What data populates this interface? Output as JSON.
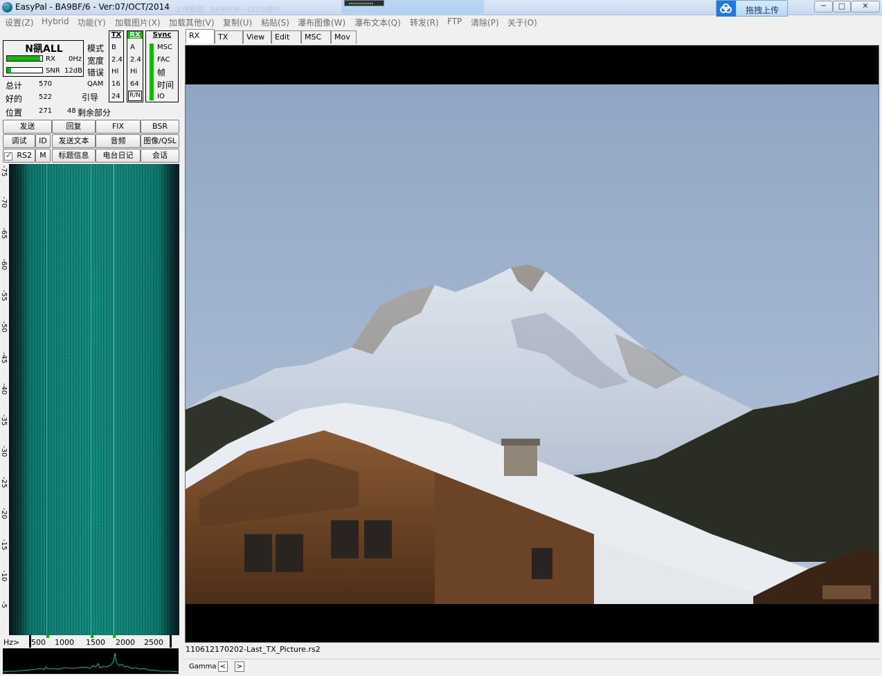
{
  "window": {
    "title": "EasyPal - BA9BF/6 - Ver:07/OCT/2014",
    "taskbar_ghost": "上传截图　BA9BF/6 - 127.0图片",
    "upload_label": "拖拽上传",
    "minimize": "─",
    "maximize": "□",
    "close": "✕"
  },
  "menu": [
    "设置(Z)",
    "Hybrid",
    "功能(Y)",
    "加载图片(X)",
    "加载其他(V)",
    "复制(U)",
    "粘贴(S)",
    "瀑布图像(W)",
    "瀑布文本(Q)",
    "转发(R)",
    "FTP",
    "清除(P)",
    "关于(O)"
  ],
  "status": {
    "mode_title": "N谻ALL",
    "rx_label": "RX",
    "rx_value": "0Hz",
    "rx_level": 0.95,
    "snr_label": "SNR",
    "snr_value": "12dB",
    "snr_level": 0.12,
    "labels": {
      "mode": "模式",
      "width": "宽度",
      "error": "错误",
      "qam": "QAM",
      "guide": "引导"
    },
    "stats": [
      {
        "label": "总计",
        "value": "570"
      },
      {
        "label": "好的",
        "value": "522"
      },
      {
        "label": "位置",
        "value": "271",
        "extra_value": "48",
        "extra_label": "剩余部分"
      }
    ]
  },
  "flags": {
    "tx": {
      "head": "TX",
      "values": [
        "B",
        "2.4",
        "HI",
        "16",
        "24"
      ]
    },
    "rx": {
      "head": "RX",
      "values": [
        "A",
        "2.4",
        "Hi",
        "64",
        "R/N"
      ]
    },
    "sync": {
      "head": "Sync",
      "items": [
        "MSC",
        "FAC",
        "帧",
        "时间",
        "IO"
      ]
    }
  },
  "buttons": {
    "row1": [
      "发送",
      "回复",
      "FIX",
      "BSR"
    ],
    "row2": [
      "调试",
      "ID",
      "发送文本",
      "音频",
      "图像/QSL"
    ],
    "row3": [
      "RS2",
      "M",
      "标题信息",
      "电台日记",
      "会话"
    ]
  },
  "waterfall": {
    "scale_labels": [
      "-75",
      "-70",
      "-65",
      "-60",
      "-55",
      "-50",
      "-45",
      "-40",
      "-35",
      "-30",
      "-25",
      "-20",
      "-15",
      "-10",
      "-5"
    ],
    "freq_unit": "Hz>",
    "freq_labels": [
      "500",
      "1000",
      "1500",
      "2000",
      "2500"
    ]
  },
  "tabs": [
    "RX",
    "TX",
    "View",
    "Edit",
    "MSC",
    "Mov"
  ],
  "active_tab": "RX",
  "file_name": "110612170202-Last_TX_Picture.rs2",
  "gamma": {
    "label": "Gamma",
    "prev": "<",
    "next": ">"
  },
  "colors": {
    "bar_green": "#00c000",
    "waterfall": "#1a8a80",
    "menu_text": "#6b6b6b",
    "accent": "#1c7be0"
  }
}
